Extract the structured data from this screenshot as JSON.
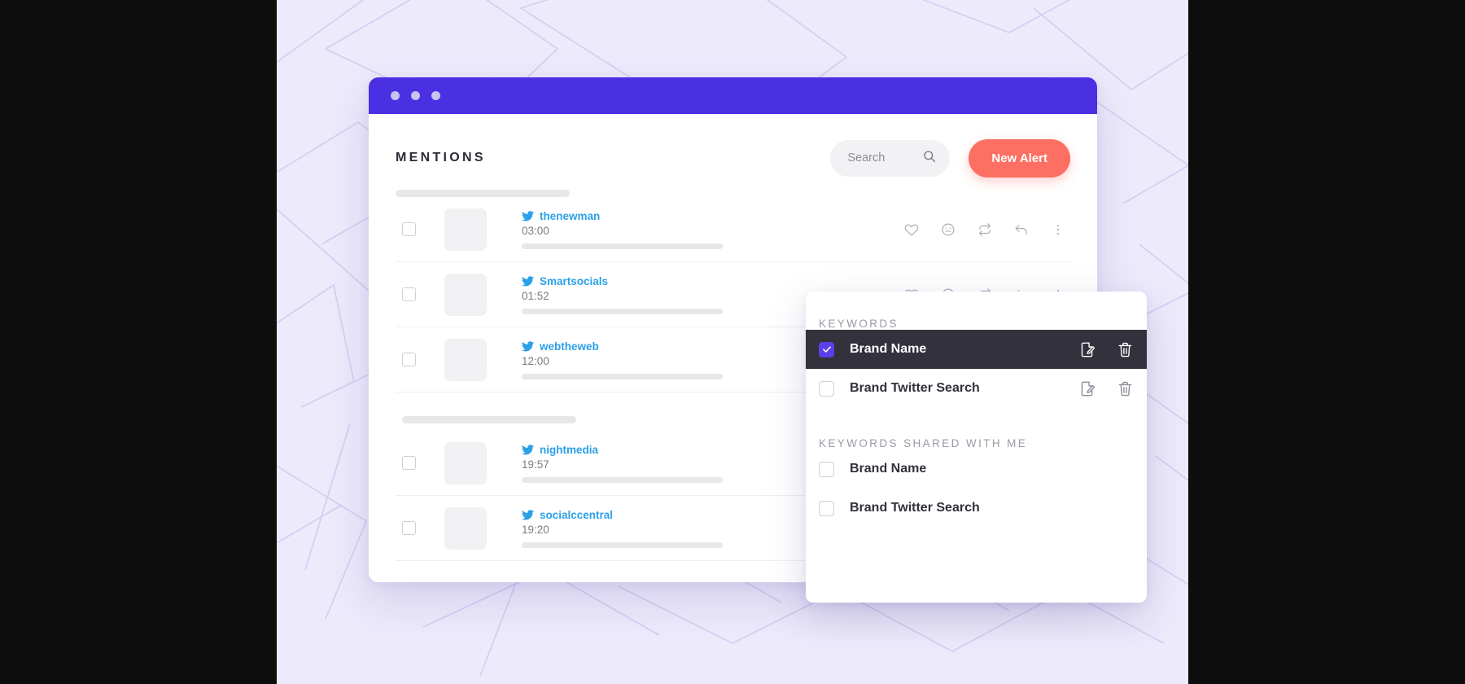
{
  "window": {
    "titlebar_dots": [
      "dot-1",
      "dot-2",
      "dot-3"
    ],
    "accent_purple": "#4B2FE3"
  },
  "header": {
    "title": "MENTIONS",
    "search": {
      "placeholder": "Search",
      "value": "",
      "icon": "search-icon"
    },
    "new_alert_label": "New Alert",
    "new_alert_color": "#FC6F62"
  },
  "mentions": {
    "groups": [
      {
        "items": [
          {
            "handle": "thenewman",
            "time": "03:00",
            "network": "twitter",
            "checked": false
          },
          {
            "handle": "Smartsocials",
            "time": "01:52",
            "network": "twitter",
            "checked": false
          },
          {
            "handle": "webtheweb",
            "time": "12:00",
            "network": "twitter",
            "checked": false
          }
        ]
      },
      {
        "items": [
          {
            "handle": "nightmedia",
            "time": "19:57",
            "network": "twitter",
            "checked": false
          },
          {
            "handle": "socialccentral",
            "time": "19:20",
            "network": "twitter",
            "checked": false
          }
        ]
      }
    ],
    "row_action_icons": [
      "heart-icon",
      "emoji-icon",
      "retweet-icon",
      "reply-icon",
      "more-options-icon"
    ],
    "twitter_blue": "#2CA0E8"
  },
  "keywords_panel": {
    "sections": [
      {
        "title": "KEYWORDS",
        "items": [
          {
            "label": "Brand Name",
            "checked": true,
            "has_actions": true
          },
          {
            "label": "Brand Twitter Search",
            "checked": false,
            "has_actions": true
          }
        ]
      },
      {
        "title": "KEYWORDS SHARED WITH ME",
        "items": [
          {
            "label": "Brand Name",
            "checked": false,
            "has_actions": false
          },
          {
            "label": "Brand Twitter Search",
            "checked": false,
            "has_actions": false
          }
        ]
      }
    ],
    "action_icons": [
      "edit-icon",
      "delete-icon"
    ],
    "selected_row_bg": "#32313C",
    "checkbox_checked_color": "#5B3FE8"
  }
}
